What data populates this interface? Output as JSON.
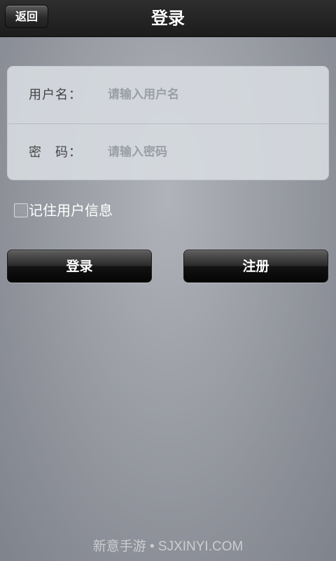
{
  "navbar": {
    "back_label": "返回",
    "title": "登录"
  },
  "form": {
    "username": {
      "label": "用户名：",
      "placeholder": "请输入用户名",
      "value": ""
    },
    "password": {
      "label": "密　码：",
      "placeholder": "请输入密码",
      "value": ""
    }
  },
  "remember": {
    "label": "记住用户信息",
    "checked": false
  },
  "actions": {
    "login_label": "登录",
    "register_label": "注册"
  },
  "watermark": "新意手游 • SJXINYI.COM"
}
